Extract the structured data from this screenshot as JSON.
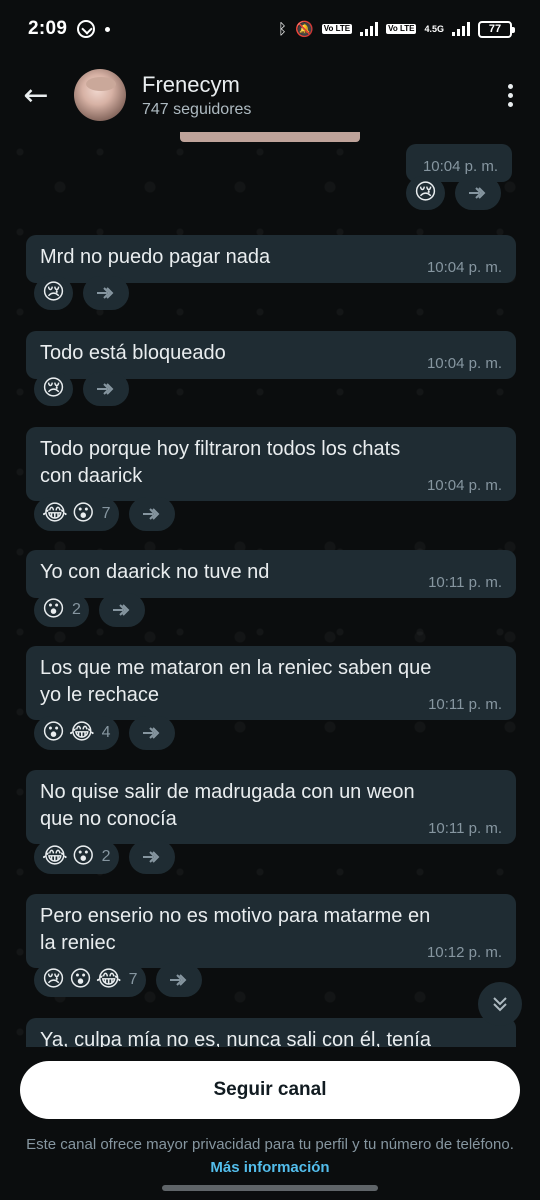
{
  "status_bar": {
    "time": "2:09",
    "network_badge": "Vo LTE",
    "network_type": "4.5G",
    "battery": "77"
  },
  "header": {
    "channel_name": "Frenecym",
    "followers": "747 seguidores"
  },
  "messages": [
    {
      "text": "",
      "time": "10:04 p. m.",
      "reactions": [
        {
          "emoji": "😢",
          "count": ""
        }
      ]
    },
    {
      "text": "Mrd no puedo pagar nada",
      "time": "10:04 p. m.",
      "reactions": [
        {
          "emoji": "😢",
          "count": ""
        }
      ]
    },
    {
      "text": "Todo está bloqueado",
      "time": "10:04 p. m.",
      "reactions": [
        {
          "emoji": "😢",
          "count": ""
        }
      ]
    },
    {
      "text": "Todo porque hoy filtraron todos los chats\ncon daarick",
      "time": "10:04 p. m.",
      "reactions": [
        {
          "emoji": "😂",
          "count": ""
        },
        {
          "emoji": "😮",
          "count": "7"
        }
      ]
    },
    {
      "text": "Yo con daarick no tuve nd",
      "time": "10:11 p. m.",
      "reactions": [
        {
          "emoji": "😮",
          "count": "2"
        }
      ]
    },
    {
      "text": "Los que me mataron en la reniec saben que\nyo le rechace",
      "time": "10:11 p. m.",
      "reactions": [
        {
          "emoji": "😮",
          "count": ""
        },
        {
          "emoji": "😂",
          "count": "4"
        }
      ]
    },
    {
      "text": "No quise salir de madrugada con un weon\nque no conocía",
      "time": "10:11 p. m.",
      "reactions": [
        {
          "emoji": "😂",
          "count": ""
        },
        {
          "emoji": "😮",
          "count": "2"
        }
      ]
    },
    {
      "text": "Pero enserio no es motivo para matarme en\nla reniec",
      "time": "10:12 p. m.",
      "reactions": [
        {
          "emoji": "😢",
          "count": ""
        },
        {
          "emoji": "😮",
          "count": ""
        },
        {
          "emoji": "😂",
          "count": "7"
        }
      ]
    },
    {
      "text": "Ya, culpa mía no es, nunca sali con él, tenía",
      "time": "",
      "reactions": []
    }
  ],
  "footer": {
    "follow_label": "Seguir canal",
    "privacy_text": "Este canal ofrece mayor privacidad para tu perfil y tu número de teléfono.",
    "more_info": "Más información"
  },
  "colors": {
    "background": "#0b0d0e",
    "bubble": "#1f2c33",
    "link": "#53bdeb"
  },
  "icons": [
    "back-arrow-icon",
    "more-options-icon",
    "forward-icon",
    "scroll-down-icon",
    "whatsapp-icon",
    "bluetooth-icon",
    "mute-icon",
    "battery-icon"
  ]
}
